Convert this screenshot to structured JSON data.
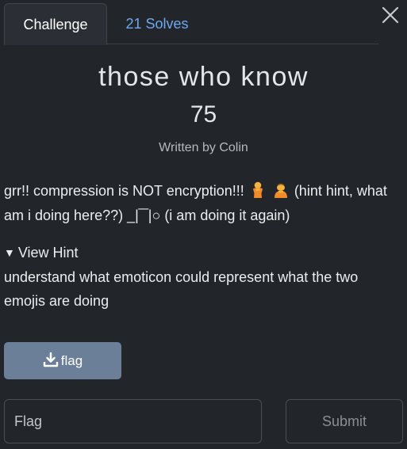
{
  "tabs": {
    "challenge_label": "Challenge",
    "solves_label": "21 Solves"
  },
  "challenge": {
    "title": "those who know",
    "points": "75",
    "author": "Written by Colin",
    "description_part1": "grr!! compression is NOT encryption!!!",
    "description_emoji_1": "person-icon",
    "description_emoji_2": "person-bowing-icon",
    "description_part2": "(hint hint, what am i doing here??)  _|‾‾|○ (i am doing it again)"
  },
  "hint": {
    "toggle_label": "View Hint",
    "text": "understand what emoticon could represent what the two emojis are doing"
  },
  "file": {
    "label": "flag",
    "icon": "download-icon"
  },
  "submission": {
    "placeholder": "Flag",
    "value": "",
    "submit_label": "Submit"
  },
  "colors": {
    "background": "#22252a",
    "tab_active_bg": "#2b2f35",
    "link_blue": "#6ea8ef",
    "file_button": "#6c7f99",
    "border": "#4a4f57"
  }
}
